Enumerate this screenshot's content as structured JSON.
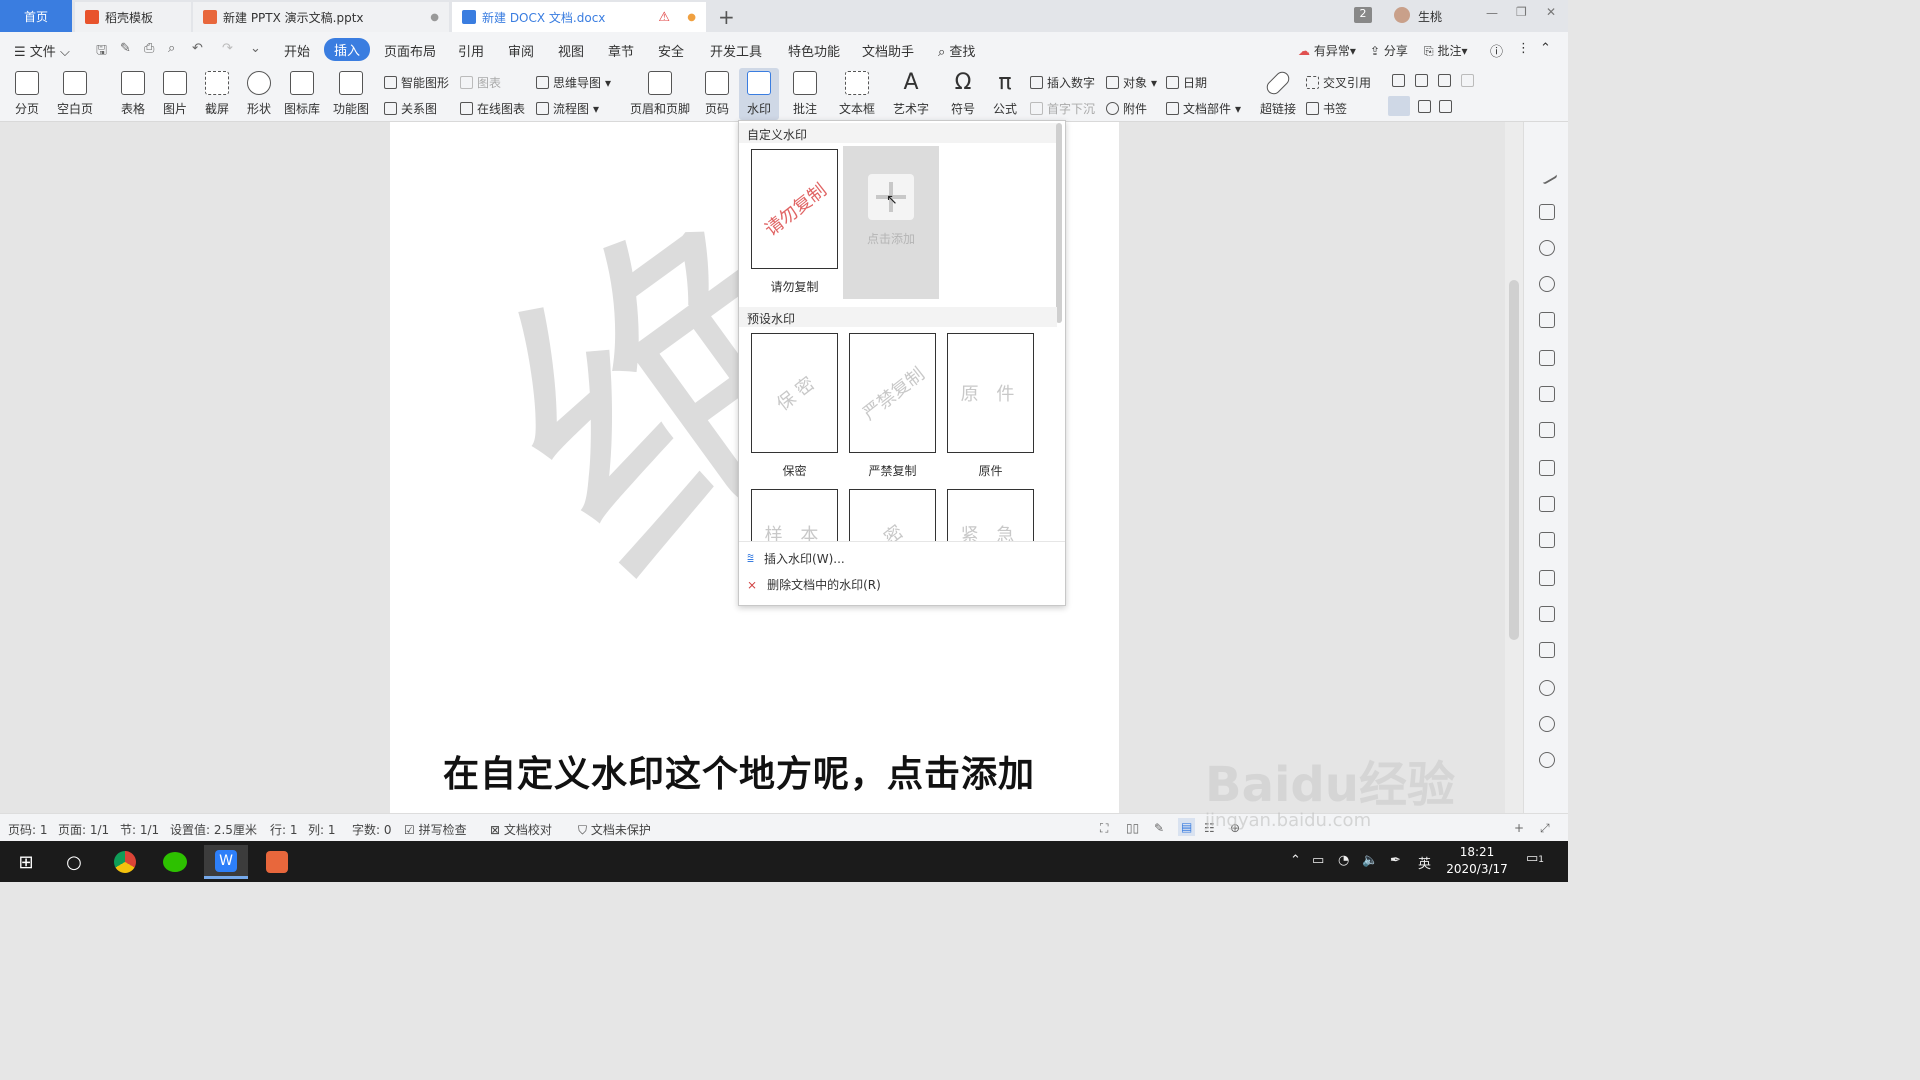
{
  "tabs": {
    "home": "首页",
    "template": "稻壳模板",
    "pptx": "新建 PPTX 演示文稿.pptx",
    "docx": "新建 DOCX 文档.docx"
  },
  "titlebar": {
    "badge": "2",
    "user": "生桃"
  },
  "menu": {
    "file": "文件",
    "items": [
      "开始",
      "插入",
      "页面布局",
      "引用",
      "审阅",
      "视图",
      "章节",
      "安全",
      "开发工具",
      "特色功能",
      "文档助手"
    ],
    "search": "查找",
    "right": {
      "abnormal": "有异常",
      "share": "分享",
      "comment": "批注"
    }
  },
  "ribbon": {
    "page_break": "分页",
    "blank_page": "空白页",
    "table": "表格",
    "picture": "图片",
    "screenshot": "截屏",
    "shape": "形状",
    "icons": "图标库",
    "func_chart": "功能图",
    "smart_shape": "智能图形",
    "chart": "图表",
    "mindmap": "思维导图",
    "relation": "关系图",
    "online_chart": "在线图表",
    "flowchart": "流程图",
    "header_footer": "页眉和页脚",
    "page_no": "页码",
    "watermark": "水印",
    "comment": "批注",
    "textbox": "文本框",
    "art_text": "艺术字",
    "symbol": "符号",
    "formula": "公式",
    "insert_number": "插入数字",
    "object": "对象",
    "date": "日期",
    "drop_cap": "首字下沉",
    "attachment": "附件",
    "doc_parts": "文档部件",
    "hyperlink": "超链接",
    "cross_ref": "交叉引用",
    "bookmark": "书签"
  },
  "dropdown": {
    "custom_title": "自定义水印",
    "custom_items": [
      {
        "text": "请勿复制",
        "label": "请勿复制"
      }
    ],
    "add_label": "点击添加",
    "preset_title": "预设水印",
    "preset_items": [
      {
        "text": "保 密",
        "label": "保密"
      },
      {
        "text": "严禁复制",
        "label": "严禁复制"
      },
      {
        "text": "原 件",
        "label": "原件"
      }
    ],
    "preset_row2": [
      "样 本",
      "密",
      "紧 急"
    ],
    "insert_action": "插入水印(W)...",
    "delete_action": "删除文档中的水印(R)"
  },
  "document": {
    "watermark_char": "绝",
    "caption": "在自定义水印这个地方呢，点击添加"
  },
  "status": {
    "page_no": "页码: 1",
    "pages": "页面: 1/1",
    "section": "节: 1/1",
    "setting": "设置值: 2.5厘米",
    "row": "行: 1",
    "col": "列: 1",
    "words": "字数: 0",
    "spell": "拼写检查",
    "proof": "文档校对",
    "protect": "文档未保护"
  },
  "taskbar": {
    "time": "18:21",
    "date": "2020/3/17",
    "ime": "英",
    "notifications": "1"
  },
  "overlay": {
    "baidu": "Baidu经验",
    "url": "jingyan.baidu.com"
  },
  "colors": {
    "accent": "#3a7de0",
    "red_watermark": "#e06464"
  }
}
